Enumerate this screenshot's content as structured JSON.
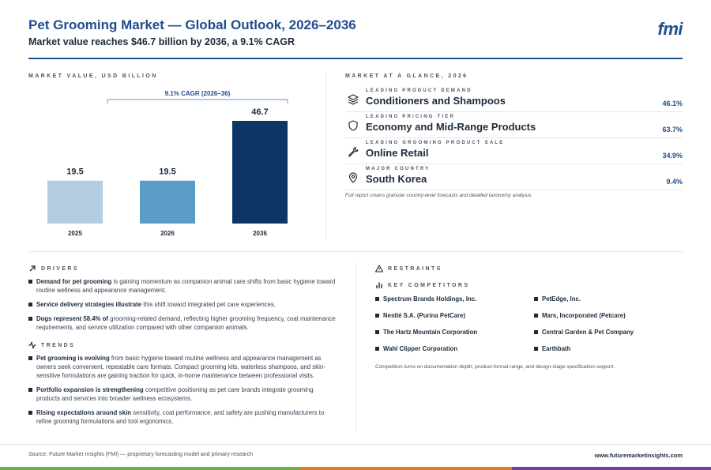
{
  "header": {
    "title": "Pet Grooming Market — Global Outlook, 2026–2036",
    "subtitle": "Market value reaches $46.7 billion by 2036, a 9.1% CAGR",
    "logo": "fmi"
  },
  "chart_section_label": "MARKET VALUE, USD BILLION",
  "chart_data": {
    "type": "bar",
    "categories": [
      "2025",
      "2026",
      "2036"
    ],
    "values": [
      19.5,
      19.5,
      46.7
    ],
    "data_labels": [
      "19.5",
      "19.5",
      "46.7"
    ],
    "bar_colors": [
      "#b3cde0",
      "#5b9bc8",
      "#0d3566"
    ],
    "annotation": "9.1% CAGR (2026–36)",
    "ylim": [
      0,
      50
    ]
  },
  "glance": {
    "label": "MARKET AT A GLANCE, 2026",
    "items": [
      {
        "label": "LEADING PRODUCT DEMAND",
        "value": "Conditioners and Shampoos",
        "pct": "46.1%",
        "icon": "layers-icon"
      },
      {
        "label": "LEADING PRICING TIER",
        "value": "Economy and Mid-Range Products",
        "pct": "63.7%",
        "icon": "shield-icon"
      },
      {
        "label": "LEADING GROOMING PRODUCT SALE",
        "value": "Online Retail",
        "pct": "34.9%",
        "icon": "wrench-icon"
      },
      {
        "label": "MAJOR COUNTRY",
        "value": "South Korea",
        "pct": "9.4%",
        "icon": "map-pin-icon"
      }
    ],
    "note": "Full report covers granular country-level forecasts and detailed taxonomy analysis."
  },
  "drivers": {
    "label": "DRIVERS",
    "items": [
      {
        "bold": "Demand for pet grooming",
        "text": " is gaining momentum as companion animal care shifts from basic hygiene toward routine wellness and appearance management."
      },
      {
        "bold": "Service delivery strategies illustrate",
        "text": " this shift toward integrated pet care experiences."
      },
      {
        "bold": "Dogs represent 58.4% of",
        "text": " grooming-related demand, reflecting higher grooming frequency, coat maintenance requirements, and service utilization compared with other companion animals."
      }
    ]
  },
  "trends": {
    "label": "TRENDS",
    "items": [
      {
        "bold": "Pet grooming is evolving",
        "text": " from basic hygiene toward routine wellness and appearance management as owners seek convenient, repeatable care formats. Compact grooming kits, waterless shampoos, and skin-sensitive formulations are gaining traction for quick, in-home maintenance between professional visits."
      },
      {
        "bold": "Portfolio expansion is strengthening",
        "text": " competitive positioning as pet care brands integrate grooming products and services into broader wellness ecosystems."
      },
      {
        "bold": "Rising expectations around skin",
        "text": " sensitivity, coat performance, and safety are pushing manufacturers to refine grooming formulations and tool ergonomics."
      }
    ]
  },
  "restraints": {
    "label": "RESTRAINTS"
  },
  "competitors": {
    "label": "KEY COMPETITORS",
    "items": [
      "Spectrum Brands Holdings, Inc.",
      "PetEdge, Inc.",
      "Nestlé S.A. (Purina PetCare)",
      "Mars, Incorporated (Petcare)",
      "The Hartz Mountain Corporation",
      "Central Garden & Pet Company",
      "Wahl Clipper Corporation",
      "Earthbath"
    ],
    "note": "Competition turns on documentation depth, product-format range, and design-stage specification support."
  },
  "footer": {
    "source": "Source: Future Market Insights (FMI) — proprietary forecasting model and primary research",
    "site": "www.futuremarketinsights.com"
  },
  "colors": {
    "accent": "#1f4e8c",
    "bar_green": "#6ab04c",
    "bar_orange": "#e07b2a",
    "bar_purple": "#7b3f98"
  }
}
